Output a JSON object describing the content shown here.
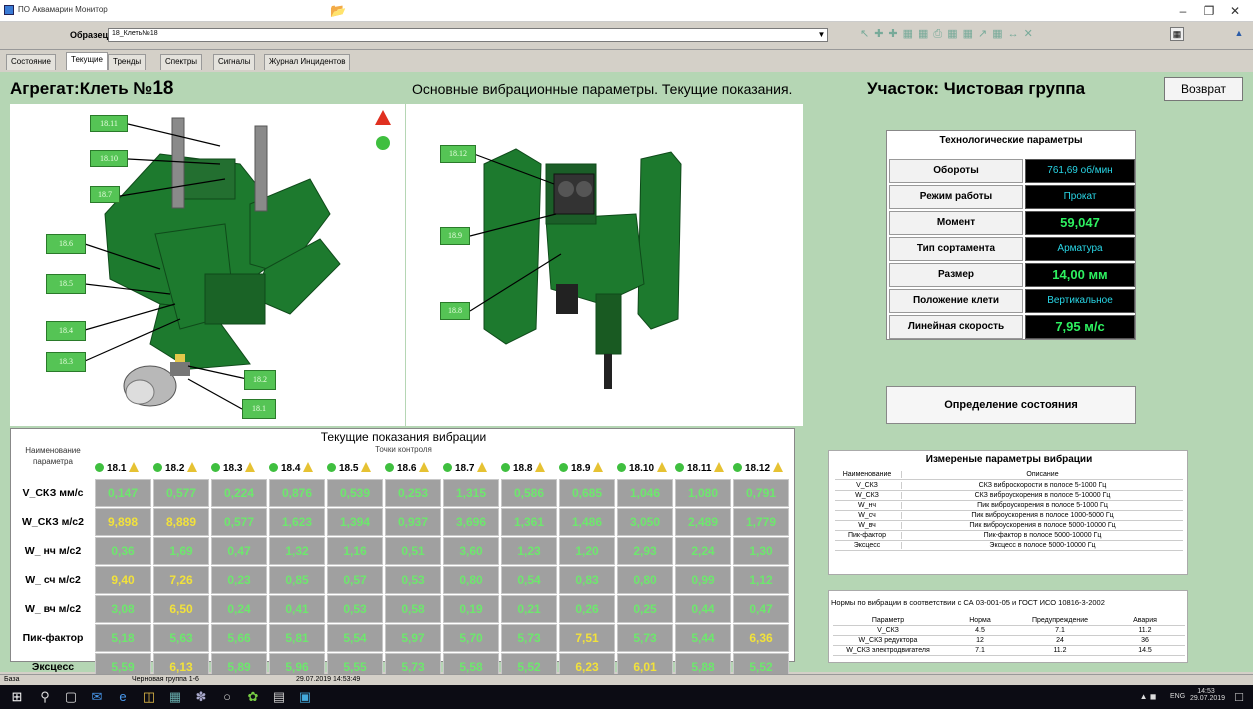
{
  "window": {
    "title": "ПО Аквамарин Монитор"
  },
  "sample": {
    "label": "Образец",
    "value": "18_Клеть№18"
  },
  "tabs": [
    "Состояние",
    "Текущие",
    "Тренды",
    "Спектры",
    "Сигналы",
    "Журнал Инцидентов"
  ],
  "active_tab": "Текущие",
  "header": {
    "unit_label": "Агрегат:Клеть №",
    "unit_number": "18",
    "subtitle": "Основные вибрационные параметры. Текущие показания.",
    "area": "Участок: Чистовая группа",
    "back_button": "Возврат"
  },
  "diagram": {
    "left_tags": [
      "18.11",
      "18.10",
      "18.7",
      "18.6",
      "18.5",
      "18.4",
      "18.3",
      "18.2",
      "18.1"
    ],
    "right_tags": [
      "18.12",
      "18.9",
      "18.8"
    ]
  },
  "tech": {
    "title": "Технологические параметры",
    "rows": [
      {
        "label": "Обороты",
        "value": "761,69 об/мин"
      },
      {
        "label": "Режим работы",
        "value": "Прокат"
      },
      {
        "label": "Момент",
        "value": "59,047"
      },
      {
        "label": "Тип сортамента",
        "value": "Арматура"
      },
      {
        "label": "Размер",
        "value": "14,00 мм"
      },
      {
        "label": "Положение клети",
        "value": "Вертикальное"
      },
      {
        "label": "Линейная скорость",
        "value": "7,95 м/с"
      }
    ]
  },
  "state_button": "Определение состояния",
  "vibration": {
    "title": "Текущие показания вибрации",
    "points_caption": "Точки контроля",
    "name_header": "Наименование параметра",
    "points": [
      "18.1",
      "18.2",
      "18.3",
      "18.4",
      "18.5",
      "18.6",
      "18.7",
      "18.8",
      "18.9",
      "18.10",
      "18.11",
      "18.12"
    ],
    "rows": [
      {
        "name": "V_СКЗ мм/с",
        "values": [
          "0,147",
          "0,577",
          "0,224",
          "0,876",
          "0,539",
          "0,253",
          "1,315",
          "0,586",
          "0,685",
          "1,046",
          "1,080",
          "0,791"
        ],
        "warn": []
      },
      {
        "name": "W_СКЗ м/с2",
        "values": [
          "9,898",
          "8,889",
          "0,577",
          "1,623",
          "1,394",
          "0,937",
          "3,696",
          "1,361",
          "1,486",
          "3,050",
          "2,489",
          "1,779"
        ],
        "warn": [
          0,
          1
        ]
      },
      {
        "name": "W_ нч м/с2",
        "values": [
          "0,36",
          "1,69",
          "0,47",
          "1,32",
          "1,16",
          "0,51",
          "3,60",
          "1,23",
          "1,20",
          "2,93",
          "2,24",
          "1,30"
        ],
        "warn": []
      },
      {
        "name": "W_ сч м/с2",
        "values": [
          "9,40",
          "7,26",
          "0,23",
          "0,85",
          "0,57",
          "0,53",
          "0,80",
          "0,54",
          "0,83",
          "0,80",
          "0,99",
          "1,12"
        ],
        "warn": [
          0,
          1
        ]
      },
      {
        "name": "W_ вч м/с2",
        "values": [
          "3,08",
          "6,50",
          "0,24",
          "0,41",
          "0,53",
          "0,58",
          "0,19",
          "0,21",
          "0,26",
          "0,25",
          "0,44",
          "0,47"
        ],
        "warn": [
          1
        ]
      },
      {
        "name": "Пик-фактор",
        "values": [
          "5,18",
          "5,63",
          "5,66",
          "5,81",
          "5,54",
          "5,97",
          "5,70",
          "5,73",
          "7,51",
          "5,73",
          "5,44",
          "6,36"
        ],
        "warn": [
          8,
          11
        ]
      },
      {
        "name": "Эксцесс",
        "values": [
          "5,59",
          "6,13",
          "5,89",
          "5,96",
          "5,55",
          "5,73",
          "5,58",
          "5,52",
          "6,23",
          "6,01",
          "5,88",
          "5,52"
        ],
        "warn": [
          1,
          8,
          9
        ]
      }
    ]
  },
  "measured": {
    "title": "Измереные параметры вибрации",
    "col_name": "Наименование",
    "col_desc": "Описание",
    "rows": [
      {
        "name": "V_СКЗ",
        "desc": "СКЗ виброскорости в полосе 5-1000 Гц"
      },
      {
        "name": "W_СКЗ",
        "desc": "СКЗ виброускорения в полосе 5-10000 Гц"
      },
      {
        "name": "W_нч",
        "desc": "Пик виброускорения в полосе 5-1000 Гц"
      },
      {
        "name": "W_сч",
        "desc": "Пик виброускорения в полосе 1000-5000 Гц"
      },
      {
        "name": "W_вч",
        "desc": "Пик виброускорения в полосе 5000-10000 Гц"
      },
      {
        "name": "Пик-фактор",
        "desc": "Пик-фактор в полосе 5000-10000 Гц"
      },
      {
        "name": "Эксцесс",
        "desc": "Эксцесс в полосе 5000-10000 Гц"
      }
    ]
  },
  "norms": {
    "title": "Нормы по вибрации в соответствии с  СА 03-001-05 и ГОСТ ИСО 10816-3-2002",
    "headers": [
      "Параметр",
      "Норма",
      "Предупреждение",
      "Авария"
    ],
    "rows": [
      [
        "V_СКЗ",
        "4.5",
        "7.1",
        "11.2"
      ],
      [
        "W_СКЗ редуктора",
        "12",
        "24",
        "36"
      ],
      [
        "W_СКЗ электродвигателя",
        "7.1",
        "11.2",
        "14.5"
      ]
    ]
  },
  "status": {
    "left": "База",
    "group": "Черновая группа 1-6",
    "datetime": "29.07.2019 14:53:49"
  },
  "taskbar": {
    "lang": "ENG",
    "time": "14:53",
    "date": "29.07.2019"
  },
  "colors": {
    "panel_bg": "#b5d6b4",
    "ok_green": "#6de86d",
    "warn_yellow": "#f2e23a",
    "alarm_red": "#e03020",
    "display_cyan": "#29d6e6"
  }
}
